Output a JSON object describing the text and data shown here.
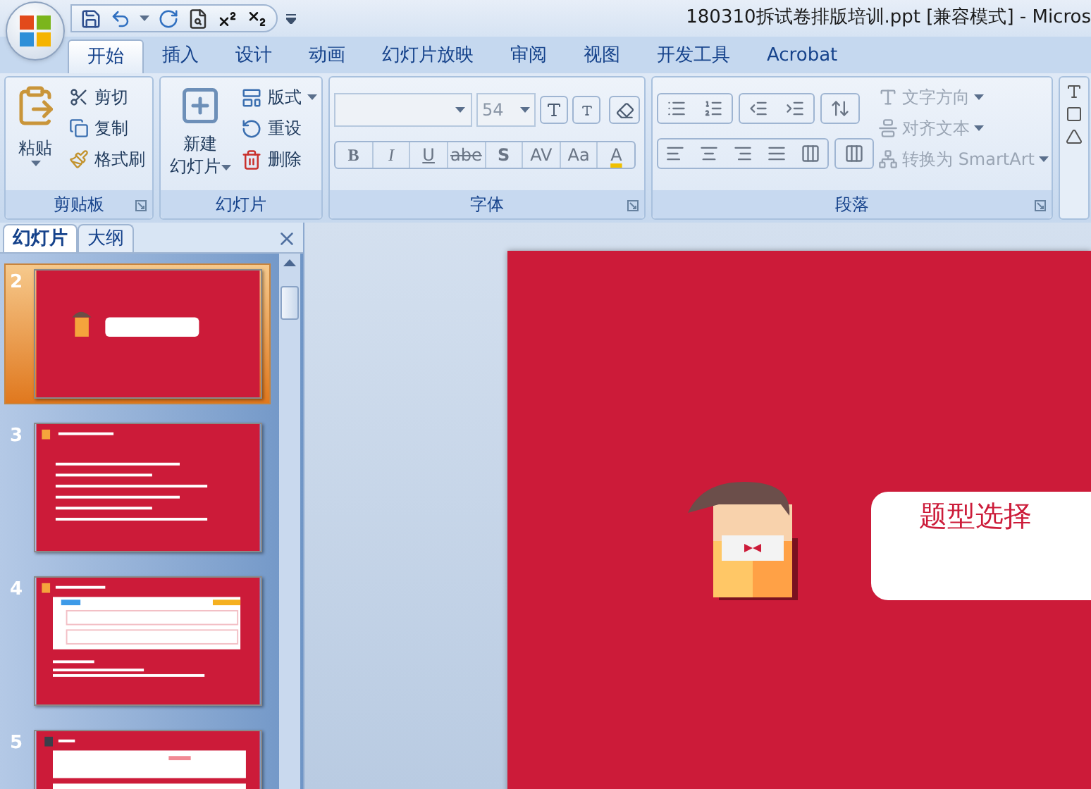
{
  "window": {
    "title": "180310拆试卷排版培训.ppt [兼容模式] - Micros"
  },
  "tabs": [
    {
      "label": "开始",
      "selected": true
    },
    {
      "label": "插入",
      "selected": false
    },
    {
      "label": "设计",
      "selected": false
    },
    {
      "label": "动画",
      "selected": false
    },
    {
      "label": "幻灯片放映",
      "selected": false
    },
    {
      "label": "审阅",
      "selected": false
    },
    {
      "label": "视图",
      "selected": false
    },
    {
      "label": "开发工具",
      "selected": false
    },
    {
      "label": "Acrobat",
      "selected": false
    }
  ],
  "clipboard": {
    "label": "剪贴板",
    "paste": "粘贴",
    "items": [
      "剪切",
      "复制",
      "格式刷"
    ]
  },
  "slides_group": {
    "label": "幻灯片",
    "new_slide": [
      "新建",
      "幻灯片"
    ],
    "items": [
      "版式",
      "重设",
      "删除"
    ]
  },
  "font": {
    "label": "字体",
    "font_size": "54",
    "format_buttons": [
      "B",
      "I",
      "U",
      "abe",
      "S",
      "AV",
      "Aa",
      "A"
    ]
  },
  "paragraph": {
    "label": "段落",
    "items": [
      {
        "label": "文字方向",
        "disabled": true
      },
      {
        "label": "对齐文本",
        "disabled": true
      },
      {
        "label": "转换为 SmartArt",
        "disabled": true
      }
    ]
  },
  "pane": {
    "tabs": [
      {
        "label": "幻灯片",
        "selected": true
      },
      {
        "label": "大纲",
        "selected": false
      }
    ],
    "slides": [
      {
        "number": "2",
        "selected": true,
        "kind": "title"
      },
      {
        "number": "3",
        "selected": false,
        "kind": "text"
      },
      {
        "number": "4",
        "selected": false,
        "kind": "table"
      },
      {
        "number": "5",
        "selected": false,
        "kind": "exercise"
      }
    ]
  },
  "slide": {
    "heading": "题型选择"
  }
}
